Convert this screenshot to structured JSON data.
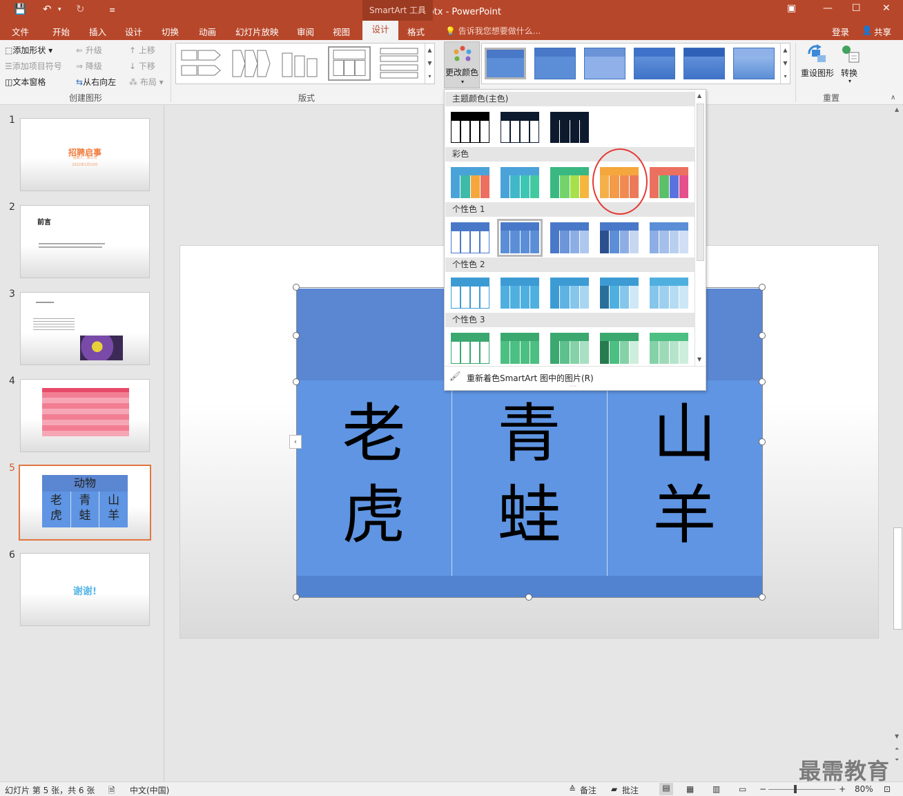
{
  "titlebar": {
    "doc_title": "谢谢.pptx - PowerPoint",
    "context_tab": "SmartArt 工具"
  },
  "tabs": [
    "文件",
    "开始",
    "插入",
    "设计",
    "切换",
    "动画",
    "幻灯片放映",
    "审阅",
    "视图",
    "设计",
    "格式"
  ],
  "tellme": "告诉我您想要做什么...",
  "account": {
    "signin": "登录",
    "share": "共享"
  },
  "ribbon": {
    "create": {
      "add_shape": "添加形状",
      "add_bullet": "添加项目符号",
      "text_pane": "文本窗格",
      "promote": "升级",
      "demote": "降级",
      "rtl": "从右向左",
      "move_up": "上移",
      "move_down": "下移",
      "layout": "布局",
      "label": "创建图形"
    },
    "layouts_label": "版式",
    "change_colors": "更改颜色",
    "reset": {
      "reset_graphic": "重设图形",
      "convert": "转换",
      "label": "重置"
    }
  },
  "slides": [
    {
      "num": "1",
      "title": "招聘启事",
      "sub": "招聘人：某公司",
      "date": "2022年1月10日"
    },
    {
      "num": "2",
      "title": "前言"
    },
    {
      "num": "3"
    },
    {
      "num": "4"
    },
    {
      "num": "5",
      "title": "动物",
      "cells": [
        "老虎",
        "青蛙",
        "山羊"
      ]
    },
    {
      "num": "6",
      "title": "谢谢!"
    }
  ],
  "smartart": {
    "cells": [
      {
        "a": "老",
        "b": "虎"
      },
      {
        "a": "青",
        "b": "蛙"
      },
      {
        "a": "山",
        "b": "羊"
      }
    ]
  },
  "dropdown": {
    "headers": [
      "主题颜色(主色)",
      "彩色",
      "个性色 1",
      "个性色 2",
      "个性色 3"
    ],
    "recolor": "重新着色SmartArt 图中的图片(R)",
    "highlight_color": "#e53935"
  },
  "status": {
    "slide_info": "幻灯片 第 5 张，共 6 张",
    "lang": "中文(中国)",
    "notes": "备注",
    "comments": "批注",
    "zoom": "80%"
  },
  "watermark": "最需教育"
}
